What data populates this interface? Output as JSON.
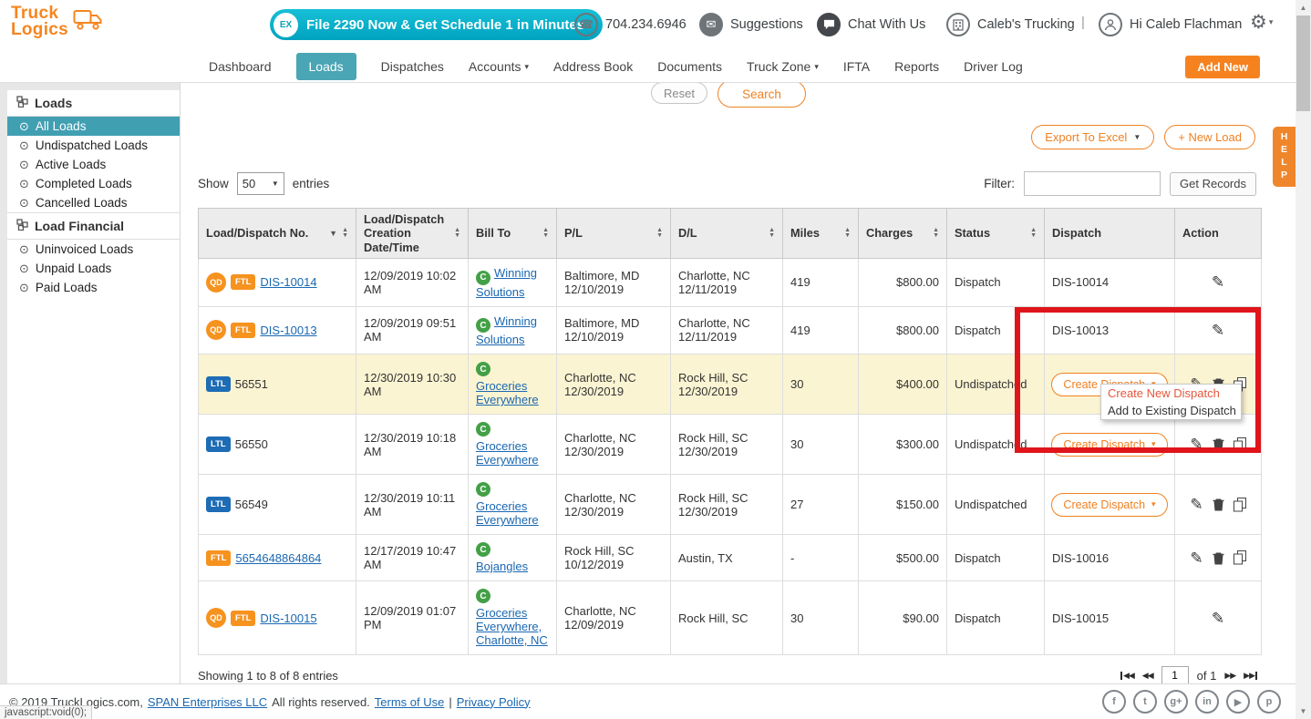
{
  "header": {
    "logo_line1": "Truck",
    "logo_line2": "Logics",
    "promo_icon": "EX",
    "promo_banner": "File 2290 Now & Get Schedule 1 in Minutes",
    "phone": "704.234.6946",
    "suggestions_label": "Suggestions",
    "chat_label": "Chat With Us",
    "company_name": "Caleb's Trucking",
    "divider": "|",
    "user_greeting": "Hi Caleb Flachman"
  },
  "nav": {
    "items": [
      {
        "label": "Dashboard",
        "active": false,
        "caret": false
      },
      {
        "label": "Loads",
        "active": true,
        "caret": false
      },
      {
        "label": "Dispatches",
        "active": false,
        "caret": false
      },
      {
        "label": "Accounts",
        "active": false,
        "caret": true
      },
      {
        "label": "Address Book",
        "active": false,
        "caret": false
      },
      {
        "label": "Documents",
        "active": false,
        "caret": false
      },
      {
        "label": "Truck Zone",
        "active": false,
        "caret": true
      },
      {
        "label": "IFTA",
        "active": false,
        "caret": false
      },
      {
        "label": "Reports",
        "active": false,
        "caret": false
      },
      {
        "label": "Driver Log",
        "active": false,
        "caret": false
      }
    ],
    "add_new_label": "Add New"
  },
  "sidebar": {
    "sections": [
      {
        "title": "Loads",
        "items": [
          {
            "label": "All Loads",
            "active": true
          },
          {
            "label": "Undispatched Loads",
            "active": false
          },
          {
            "label": "Active Loads",
            "active": false
          },
          {
            "label": "Completed Loads",
            "active": false
          },
          {
            "label": "Cancelled Loads",
            "active": false
          }
        ]
      },
      {
        "title": "Load Financial",
        "items": [
          {
            "label": "Uninvoiced Loads",
            "active": false
          },
          {
            "label": "Unpaid Loads",
            "active": false
          },
          {
            "label": "Paid Loads",
            "active": false
          }
        ]
      }
    ]
  },
  "toolbar": {
    "reset_label": "Reset",
    "search_label": "Search",
    "export_label": "Export To Excel",
    "new_load_label": "+ New Load",
    "show_label": "Show",
    "page_size": "50",
    "entries_label": "entries",
    "filter_label": "Filter:",
    "get_records_label": "Get Records"
  },
  "table": {
    "headers": [
      {
        "label": "Load/Dispatch No.",
        "sortable": true,
        "filter": true
      },
      {
        "label": "Load/Dispatch Creation Date/Time",
        "sortable": true,
        "filter": false
      },
      {
        "label": "Bill To",
        "sortable": true,
        "filter": false
      },
      {
        "label": "P/L",
        "sortable": true,
        "filter": false
      },
      {
        "label": "D/L",
        "sortable": true,
        "filter": false
      },
      {
        "label": "Miles",
        "sortable": true,
        "filter": false
      },
      {
        "label": "Charges",
        "sortable": true,
        "filter": false
      },
      {
        "label": "Status",
        "sortable": true,
        "filter": false
      },
      {
        "label": "Dispatch",
        "sortable": false,
        "filter": false
      },
      {
        "label": "Action",
        "sortable": false,
        "filter": false
      }
    ],
    "rows": [
      {
        "badges": [
          "QD",
          "FTL"
        ],
        "load_no": "DIS-10014",
        "load_no_link": true,
        "created": "12/09/2019 10:02 AM",
        "bill_to": "Winning Solutions",
        "icon_own_line": false,
        "pl": "Baltimore, MD\n12/10/2019",
        "dl": "Charlotte, NC\n12/11/2019",
        "miles": "419",
        "charges": "$800.00",
        "status": "Dispatch",
        "dispatch_type": "text",
        "dispatch_value": "DIS-10014",
        "actions": [
          "edit"
        ],
        "highlighted": false
      },
      {
        "badges": [
          "QD",
          "FTL"
        ],
        "load_no": "DIS-10013",
        "load_no_link": true,
        "created": "12/09/2019 09:51 AM",
        "bill_to": "Winning Solutions",
        "icon_own_line": false,
        "pl": "Baltimore, MD\n12/10/2019",
        "dl": "Charlotte, NC\n12/11/2019",
        "miles": "419",
        "charges": "$800.00",
        "status": "Dispatch",
        "dispatch_type": "text",
        "dispatch_value": "DIS-10013",
        "actions": [
          "edit"
        ],
        "highlighted": false
      },
      {
        "badges": [
          "LTL"
        ],
        "load_no": "56551",
        "load_no_link": false,
        "created": "12/30/2019 10:30 AM",
        "bill_to": "Groceries Everywhere",
        "icon_own_line": true,
        "pl": "Charlotte, NC\n12/30/2019",
        "dl": "Rock Hill, SC\n12/30/2019",
        "miles": "30",
        "charges": "$400.00",
        "status": "Undispatched",
        "dispatch_type": "button",
        "dispatch_value": "",
        "actions": [
          "edit",
          "delete",
          "copy"
        ],
        "highlighted": true
      },
      {
        "badges": [
          "LTL"
        ],
        "load_no": "56550",
        "load_no_link": false,
        "created": "12/30/2019 10:18 AM",
        "bill_to": "Groceries Everywhere",
        "icon_own_line": true,
        "pl": "Charlotte, NC\n12/30/2019",
        "dl": "Rock Hill, SC\n12/30/2019",
        "miles": "30",
        "charges": "$300.00",
        "status": "Undispatched",
        "dispatch_type": "button",
        "dispatch_value": "",
        "actions": [
          "edit",
          "delete",
          "copy"
        ],
        "highlighted": false
      },
      {
        "badges": [
          "LTL"
        ],
        "load_no": "56549",
        "load_no_link": false,
        "created": "12/30/2019 10:11 AM",
        "bill_to": "Groceries Everywhere",
        "icon_own_line": true,
        "pl": "Charlotte, NC\n12/30/2019",
        "dl": "Rock Hill, SC\n12/30/2019",
        "miles": "27",
        "charges": "$150.00",
        "status": "Undispatched",
        "dispatch_type": "button",
        "dispatch_value": "",
        "actions": [
          "edit",
          "delete",
          "copy"
        ],
        "highlighted": false
      },
      {
        "badges": [
          "FTL"
        ],
        "load_no": "5654648864864",
        "load_no_link": true,
        "created": "12/17/2019 10:47 AM",
        "bill_to": "Bojangles",
        "icon_own_line": true,
        "pl": "Rock Hill, SC\n10/12/2019",
        "dl": "Austin, TX",
        "miles": "-",
        "charges": "$500.00",
        "status": "Dispatch",
        "dispatch_type": "text",
        "dispatch_value": "DIS-10016",
        "actions": [
          "edit",
          "delete",
          "copy"
        ],
        "highlighted": false
      },
      {
        "badges": [
          "QD",
          "FTL"
        ],
        "load_no": "DIS-10015",
        "load_no_link": true,
        "created": "12/09/2019 01:07 PM",
        "bill_to": "Groceries Everywhere, Charlotte, NC",
        "icon_own_line": true,
        "pl": "Charlotte, NC\n12/09/2019",
        "dl": "Rock Hill, SC",
        "miles": "30",
        "charges": "$90.00",
        "status": "Dispatch",
        "dispatch_type": "text",
        "dispatch_value": "DIS-10015",
        "actions": [
          "edit"
        ],
        "highlighted": false
      }
    ]
  },
  "table_footer": {
    "showing_text": "Showing 1 to 8 of 8 entries",
    "page_value": "1",
    "of_label": "of 1"
  },
  "annotation": {
    "menu_items": [
      {
        "label": "Create New Dispatch",
        "highlight": true
      },
      {
        "label": "Add to Existing Dispatch",
        "highlight": false
      }
    ]
  },
  "footer": {
    "copyright_prefix": "© 2019 TruckLogics.com,",
    "span_link": "SPAN Enterprises LLC",
    "rights_text": "All rights reserved.",
    "terms_link": "Terms of Use",
    "separator": "|",
    "privacy_link": "Privacy Policy",
    "social": [
      {
        "name": "facebook",
        "glyph": "f"
      },
      {
        "name": "twitter",
        "glyph": "t"
      },
      {
        "name": "google-plus",
        "glyph": "g+"
      },
      {
        "name": "linkedin",
        "glyph": "in"
      },
      {
        "name": "youtube",
        "glyph": "▶"
      },
      {
        "name": "pinterest",
        "glyph": "p"
      }
    ]
  },
  "misc": {
    "help_label": "HELP",
    "statusbar_text": "javascript:void(0);",
    "create_dispatch_label": "Create Dispatch"
  },
  "icons": {
    "gear": "⚙",
    "phone": "☎",
    "envelope": "✉",
    "caret_down": "▾",
    "select_caret": "▼",
    "sort_up": "▲",
    "sort_down": "▼",
    "bullet": "⊙",
    "pencil": "✎",
    "prev": "◀◀",
    "next": "▶▶",
    "customer_initial": "C"
  },
  "colors": {
    "accent_orange": "#f6821f",
    "promo_teal": "#00a2c0",
    "nav_active_teal": "#4aa5b4",
    "link_blue": "#1a68b2",
    "badge_blue": "#1d6cb5",
    "customer_green": "#43a047",
    "row_highlight": "#fbf4d2",
    "annotation_red": "#e0151b",
    "menu_highlight": "#e4573d"
  }
}
